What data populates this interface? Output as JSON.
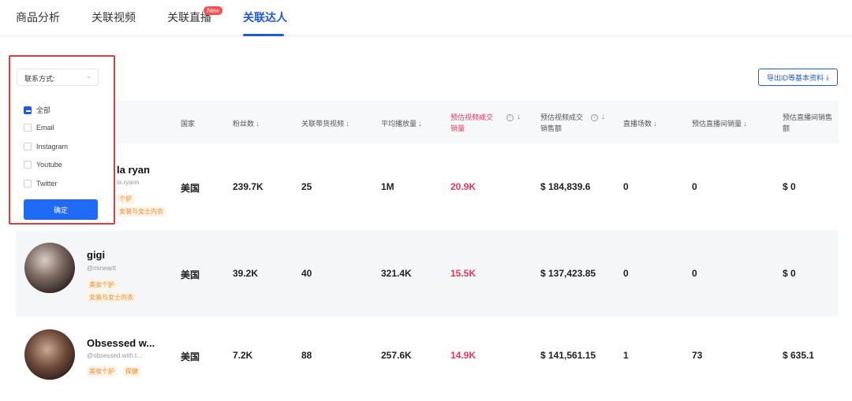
{
  "tabs": [
    {
      "label": "商品分析"
    },
    {
      "label": "关联视频"
    },
    {
      "label": "关联直播",
      "badge": "New"
    },
    {
      "label": "关联达人"
    }
  ],
  "export_button": {
    "label": "导出ID等基本资料",
    "icon": "download-icon"
  },
  "filter": {
    "select_label": "联系方式:",
    "options": [
      {
        "label": "全部",
        "checked": true
      },
      {
        "label": "Email",
        "checked": false
      },
      {
        "label": "Instagram",
        "checked": false
      },
      {
        "label": "Youtube",
        "checked": false
      },
      {
        "label": "Twitter",
        "checked": false
      }
    ],
    "confirm_label": "确定"
  },
  "table": {
    "headers": {
      "country": "国家",
      "fans": "粉丝数",
      "videos": "关联带货视频",
      "avg_views": "平均播放量",
      "est_sales_a": "预估视频成交",
      "est_sales_b": "销量",
      "est_gmv_a": "预估视频成交",
      "est_gmv_b": "销售额",
      "lives": "直播场数",
      "est_live_sales": "预估直播间销量",
      "est_live_gmv_a": "预估直播间销售",
      "est_live_gmv_b": "额"
    },
    "rows": [
      {
        "name": "la ryan",
        "handle": "la.ryann",
        "tags": [
          "个护",
          "女装与女士内衣"
        ],
        "country": "美国",
        "fans": "239.7K",
        "videos": "25",
        "avg_views": "1M",
        "est_sales": "20.9K",
        "est_gmv": "$ 184,839.6",
        "lives": "0",
        "live_sales": "0",
        "live_gmv": "$ 0"
      },
      {
        "name": "gigi",
        "handle": "@mineartt",
        "tags": [
          "美妆个护",
          "女装与女士内衣"
        ],
        "country": "美国",
        "fans": "39.2K",
        "videos": "40",
        "avg_views": "321.4K",
        "est_sales": "15.5K",
        "est_gmv": "$ 137,423.85",
        "lives": "0",
        "live_sales": "0",
        "live_gmv": "$ 0"
      },
      {
        "name": "Obsessed w...",
        "handle": "@obsessed.with.t...",
        "tags": [
          "美妆个护",
          "保健"
        ],
        "country": "美国",
        "fans": "7.2K",
        "videos": "88",
        "avg_views": "257.6K",
        "est_sales": "14.9K",
        "est_gmv": "$ 141,561.15",
        "lives": "1",
        "live_sales": "73",
        "live_gmv": "$ 635.1"
      }
    ]
  },
  "colors": {
    "accent": "#1f5bd8",
    "highlight_red": "#e8385a",
    "tag_orange": "#f08a24",
    "frame_red": "#e23b3b"
  }
}
